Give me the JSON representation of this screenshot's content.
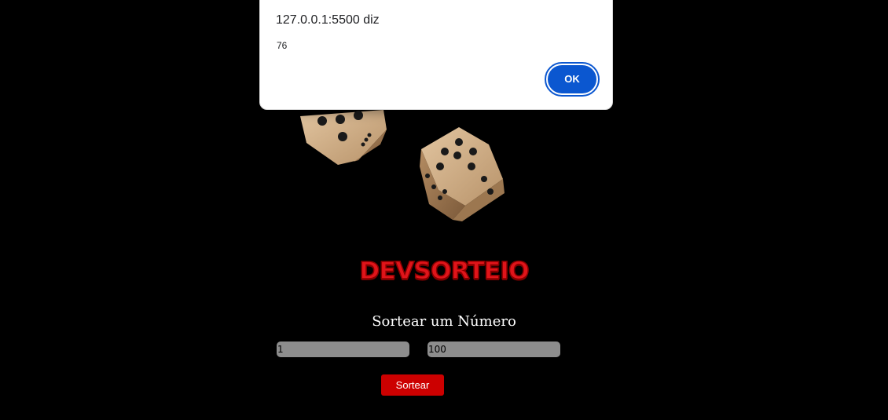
{
  "dialog": {
    "title": "127.0.0.1:5500 diz",
    "message": "76",
    "ok_label": "OK"
  },
  "logo": {
    "text": "DEVSORTEIO"
  },
  "form": {
    "heading": "Sortear um Número",
    "min_value": "1",
    "max_value": "100",
    "draw_label": "Sortear"
  },
  "colors": {
    "background": "#000000",
    "accent": "#cc0000",
    "input_bg": "#8d8d8d",
    "dialog_button": "#0b57d0",
    "dice": "#c9a77f"
  },
  "icons": {
    "dice": "dice-icon"
  }
}
